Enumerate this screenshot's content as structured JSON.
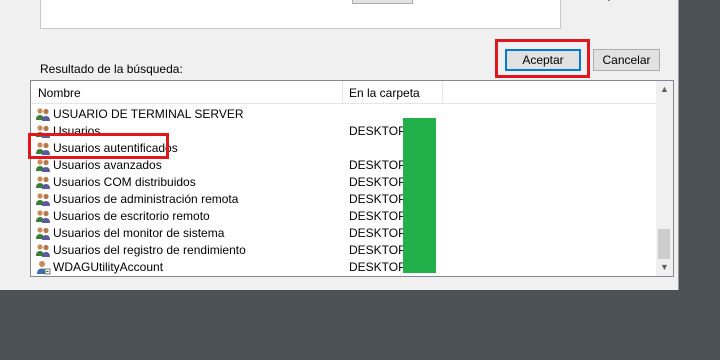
{
  "dialog": {
    "accept_label": "Aceptar",
    "cancel_label": "Cancelar",
    "results_label": "Resultado de la búsqueda:",
    "top_right_glyph": "?"
  },
  "list": {
    "columns": [
      "Nombre",
      "En la carpeta"
    ],
    "rows": [
      {
        "name": "USUARIO DE TERMINAL SERVER",
        "folder": ""
      },
      {
        "name": "Usuarios",
        "folder": "DESKTOP-"
      },
      {
        "name": "Usuarios autentificados",
        "folder": ""
      },
      {
        "name": "Usuarios avanzados",
        "folder": "DESKTOP-"
      },
      {
        "name": "Usuarios COM distribuidos",
        "folder": "DESKTOP-"
      },
      {
        "name": "Usuarios de administración remota",
        "folder": "DESKTOP-"
      },
      {
        "name": "Usuarios de escritorio remoto",
        "folder": "DESKTOP-"
      },
      {
        "name": "Usuarios del monitor de sistema",
        "folder": "DESKTOP-"
      },
      {
        "name": "Usuarios del registro de rendimiento",
        "folder": "DESKTOP-"
      },
      {
        "name": "WDAGUtilityAccount",
        "folder": "DESKTOP-"
      }
    ]
  },
  "colors": {
    "highlight": "#e0171f",
    "redaction": "#22b04b",
    "accent": "#0078d7"
  },
  "icons": {
    "group": "group-users-icon",
    "user": "user-account-icon"
  }
}
